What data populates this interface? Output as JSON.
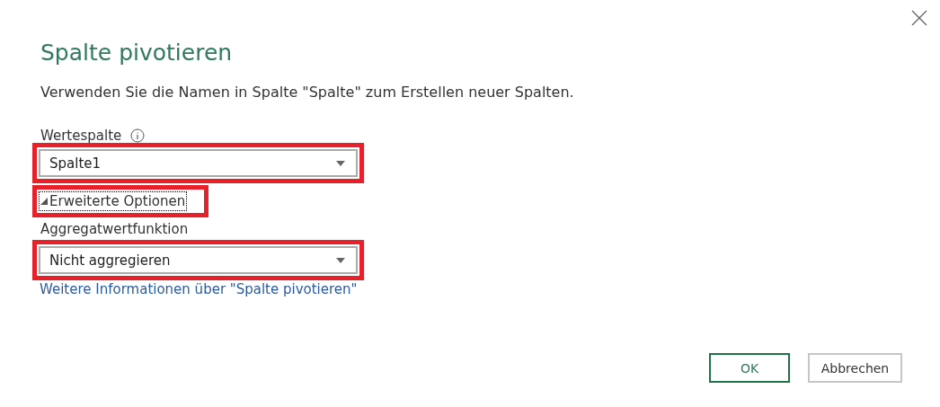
{
  "dialog": {
    "title": "Spalte pivotieren",
    "description": "Verwenden Sie die Namen in Spalte \"Spalte\" zum Erstellen neuer Spalten."
  },
  "value_column": {
    "label": "Wertespalte",
    "value": "Spalte1",
    "highlighted": true
  },
  "advanced_options": {
    "label": "Erweiterte Optionen",
    "expanded": true,
    "highlighted": true
  },
  "aggregate_function": {
    "label": "Aggregatwertfunktion",
    "value": "Nicht aggregieren",
    "highlighted": true
  },
  "help_link": "Weitere Informationen über \"Spalte pivotieren\"",
  "buttons": [
    {
      "label": "OK",
      "kind": "primary"
    },
    {
      "label": "Abbrechen",
      "kind": "secondary"
    }
  ]
}
